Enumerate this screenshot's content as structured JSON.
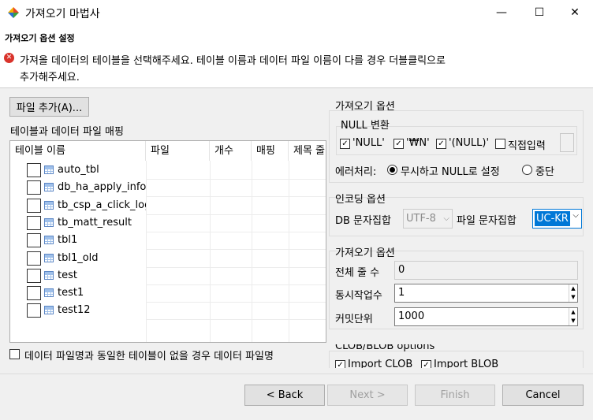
{
  "window": {
    "title": "가져오기 마법사",
    "minimize": "—",
    "maximize": "☐",
    "close": "✕"
  },
  "header": {
    "title": "가져오기 옵션 설정",
    "message_line1": "가져올 데이터의 테이블을 선택해주세요. 테이블 이름과 데이터 파일 이름이 다를 경우 더블클릭으로",
    "message_line2": "추가해주세요.",
    "message_icon": "error-icon"
  },
  "left": {
    "add_file_button": "파일 추가(A)...",
    "mapping_label": "테이블과 데이터 파일 매핑",
    "columns": [
      "테이블 이름",
      "파일",
      "개수",
      "매핑",
      "제목 줄"
    ],
    "rows": [
      {
        "name": "auto_tbl"
      },
      {
        "name": "db_ha_apply_info"
      },
      {
        "name": "tb_csp_a_click_log"
      },
      {
        "name": "tb_matt_result"
      },
      {
        "name": "tbl1"
      },
      {
        "name": "tbl1_old"
      },
      {
        "name": "test"
      },
      {
        "name": "test1"
      },
      {
        "name": "test12"
      }
    ],
    "bottom_checkbox": "데이터 파일명과 동일한 테이블이 없을 경우 데이터 파일명"
  },
  "import_options": {
    "title": "가져오기 옵션",
    "null_group": "NULL 변환",
    "null_options": [
      {
        "label": "'NULL'",
        "checked": true
      },
      {
        "label": "'₩N'",
        "checked": true
      },
      {
        "label": "'(NULL)'",
        "checked": true
      },
      {
        "label": "직접입력",
        "checked": false
      }
    ],
    "error_label": "에러처리:",
    "error_options": [
      {
        "label": "무시하고 NULL로 설정",
        "selected": true
      },
      {
        "label": "중단",
        "selected": false
      }
    ]
  },
  "encoding": {
    "title": "인코딩 옵션",
    "db_charset_label": "DB 문자집합",
    "db_charset_value": "UTF-8",
    "file_charset_label": "파일 문자집합",
    "file_charset_value": "UC-KR"
  },
  "import2": {
    "title": "가져오기 옵션",
    "total_lines_label": "전체 줄 수",
    "total_lines_value": "0",
    "concurrency_label": "동시작업수",
    "concurrency_value": "1",
    "commit_label": "커밋단위",
    "commit_value": "1000"
  },
  "clob": {
    "title": "CLOB/BLOB options",
    "options": [
      {
        "label": "Import CLOB",
        "checked": true
      },
      {
        "label": "Import BLOB",
        "checked": true
      }
    ]
  },
  "footer": {
    "back": "< Back",
    "next": "Next >",
    "finish": "Finish",
    "cancel": "Cancel"
  }
}
